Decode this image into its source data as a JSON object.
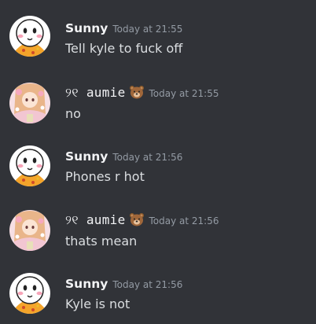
{
  "messages": [
    {
      "username": "Sunny",
      "timestamp": "Today at 21:55",
      "text": "Tell kyle to fuck off",
      "avatar_icon": "sunny-avatar",
      "badge_icon": ""
    },
    {
      "username": "୨୧ aumie",
      "timestamp": "Today at 21:55",
      "text": "no",
      "avatar_icon": "aumie-avatar",
      "badge_icon": "bear-emoji"
    },
    {
      "username": "Sunny",
      "timestamp": "Today at 21:56",
      "text": "Phones r hot",
      "avatar_icon": "sunny-avatar",
      "badge_icon": ""
    },
    {
      "username": "୨୧ aumie",
      "timestamp": "Today at 21:56",
      "text": "thats mean",
      "avatar_icon": "aumie-avatar",
      "badge_icon": "bear-emoji"
    },
    {
      "username": "Sunny",
      "timestamp": "Today at 21:56",
      "text": "Kyle is not",
      "avatar_icon": "sunny-avatar",
      "badge_icon": ""
    }
  ],
  "colors": {
    "background": "#313338",
    "username": "#f2f3f5",
    "timestamp": "#949ba4",
    "text": "#dbdee1"
  }
}
